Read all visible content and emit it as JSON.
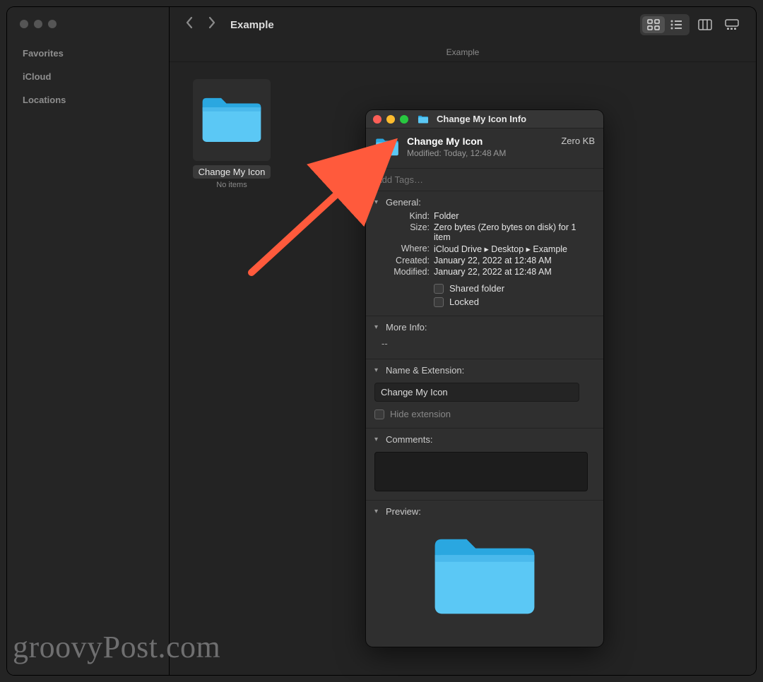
{
  "sidebar": {
    "headings": [
      "Favorites",
      "iCloud",
      "Locations"
    ]
  },
  "toolbar": {
    "title": "Example"
  },
  "path_bar": "Example",
  "folder_item": {
    "name": "Change My Icon",
    "subtitle": "No items"
  },
  "info": {
    "window_title": "Change My Icon Info",
    "name": "Change My Icon",
    "modified_header": "Modified: Today, 12:48 AM",
    "size_header": "Zero KB",
    "tags_placeholder": "Add Tags…",
    "sections": {
      "general": {
        "title": "General:",
        "kind_label": "Kind:",
        "kind_value": "Folder",
        "size_label": "Size:",
        "size_value": "Zero bytes (Zero bytes on disk) for 1 item",
        "where_label": "Where:",
        "where_value": "iCloud Drive ▸ Desktop ▸ Example",
        "created_label": "Created:",
        "created_value": "January 22, 2022 at 12:48 AM",
        "modified_label": "Modified:",
        "modified_value": "January 22, 2022 at 12:48 AM",
        "shared_label": "Shared folder",
        "locked_label": "Locked"
      },
      "more_info": {
        "title": "More Info:",
        "value": "--"
      },
      "name_ext": {
        "title": "Name & Extension:",
        "value": "Change My Icon",
        "hide_ext_label": "Hide extension"
      },
      "comments": {
        "title": "Comments:"
      },
      "preview": {
        "title": "Preview:"
      }
    }
  },
  "watermark": "groovyPost.com"
}
